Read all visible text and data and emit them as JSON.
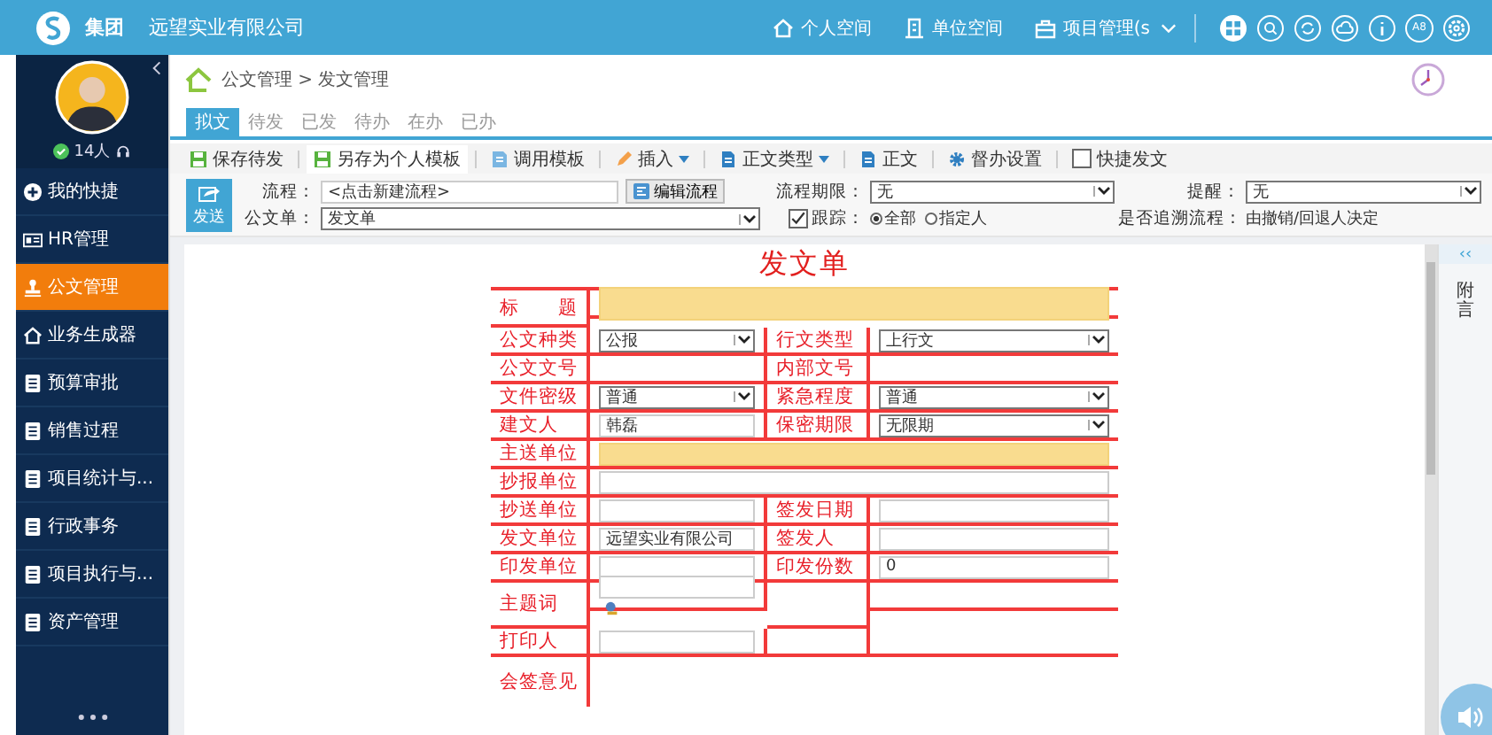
{
  "top_bar": {
    "group": "集团",
    "company": "远望实业有限公司",
    "nav": [
      {
        "label": "个人空间"
      },
      {
        "label": "单位空间"
      },
      {
        "label": "项目管理(s"
      }
    ],
    "badge": "A8"
  },
  "sidebar": {
    "online": "14人",
    "items": [
      {
        "label": "我的快捷",
        "selected": false
      },
      {
        "label": "HR管理",
        "selected": false
      },
      {
        "label": "公文管理",
        "selected": true
      },
      {
        "label": "业务生成器",
        "selected": false
      },
      {
        "label": "预算审批",
        "selected": false
      },
      {
        "label": "销售过程",
        "selected": false
      },
      {
        "label": "项目统计与...",
        "selected": false
      },
      {
        "label": "行政事务",
        "selected": false
      },
      {
        "label": "项目执行与...",
        "selected": false
      },
      {
        "label": "资产管理",
        "selected": false
      }
    ]
  },
  "breadcrumb": "公文管理 > 发文管理",
  "tabs": [
    {
      "label": "拟文",
      "selected": true
    },
    {
      "label": "待发",
      "selected": false
    },
    {
      "label": "已发",
      "selected": false
    },
    {
      "label": "待办",
      "selected": false
    },
    {
      "label": "在办",
      "selected": false
    },
    {
      "label": "已办",
      "selected": false
    }
  ],
  "toolbar": [
    {
      "kind": "button",
      "label": "保存待发"
    },
    {
      "kind": "button",
      "label": "另存为个人模板"
    },
    {
      "kind": "button",
      "label": "调用模板"
    },
    {
      "kind": "dropdown",
      "label": "插入"
    },
    {
      "kind": "dropdown",
      "label": "正文类型"
    },
    {
      "kind": "button",
      "label": "正文"
    },
    {
      "kind": "button",
      "label": "督办设置"
    },
    {
      "kind": "checkbox",
      "label": "快捷发文",
      "checked": false
    }
  ],
  "send_button": "发送",
  "flow": {
    "label": "流程：",
    "value": "<点击新建流程>",
    "edit_button": "编辑流程"
  },
  "deadline": {
    "label": "流程期限：",
    "value": "无"
  },
  "reminder": {
    "label": "提醒：",
    "value": "无"
  },
  "form_select": {
    "label": "公文单：",
    "value": "发文单"
  },
  "track": {
    "label": "跟踪：",
    "checked": true,
    "options": [
      {
        "label": "全部",
        "selected": true
      },
      {
        "label": "指定人",
        "selected": false
      }
    ]
  },
  "trace": {
    "label": "是否追溯流程：",
    "value": "由撤销/回退人决定"
  },
  "document": {
    "title": "发文单",
    "rows": [
      {
        "kind": "full",
        "label": "标　　题",
        "field": {
          "kind": "textarea",
          "required": true
        }
      },
      {
        "kind": "pair",
        "cells": [
          {
            "label": "公文种类",
            "field": {
              "kind": "select",
              "value": "公报",
              "required": false
            }
          },
          {
            "label": "行文类型",
            "field": {
              "kind": "select",
              "value": "上行文",
              "required": false
            }
          }
        ]
      },
      {
        "kind": "pair",
        "cells": [
          {
            "label": "公文文号",
            "field": {
              "kind": "none"
            }
          },
          {
            "label": "内部文号",
            "field": {
              "kind": "none"
            }
          }
        ]
      },
      {
        "kind": "pair",
        "cells": [
          {
            "label": "文件密级",
            "field": {
              "kind": "select",
              "value": "普通",
              "required": false
            }
          },
          {
            "label": "紧急程度",
            "field": {
              "kind": "select",
              "value": "普通",
              "required": false
            }
          }
        ]
      },
      {
        "kind": "pair",
        "cells": [
          {
            "label": "建文人",
            "field": {
              "kind": "input",
              "value": "韩磊",
              "required": false
            }
          },
          {
            "label": "保密期限",
            "field": {
              "kind": "select",
              "value": "无限期",
              "required": false
            }
          }
        ]
      },
      {
        "kind": "full",
        "label": "主送单位",
        "field": {
          "kind": "input",
          "required": true
        }
      },
      {
        "kind": "full",
        "label": "抄报单位",
        "field": {
          "kind": "input",
          "required": false
        }
      },
      {
        "kind": "pair",
        "cells": [
          {
            "label": "抄送单位",
            "field": {
              "kind": "input",
              "required": false
            }
          },
          {
            "label": "签发日期",
            "field": {
              "kind": "input",
              "required": false
            }
          }
        ]
      },
      {
        "kind": "pair",
        "cells": [
          {
            "label": "发文单位",
            "field": {
              "kind": "input",
              "value": "远望实业有限公司",
              "required": false
            }
          },
          {
            "label": "签发人",
            "field": {
              "kind": "input",
              "required": false
            }
          }
        ]
      },
      {
        "kind": "pair",
        "cells": [
          {
            "label": "印发单位",
            "field": {
              "kind": "input",
              "required": false
            }
          },
          {
            "label": "印发份数",
            "field": {
              "kind": "input",
              "value": "0",
              "required": false
            }
          }
        ]
      },
      {
        "kind": "single",
        "label": "主题词",
        "field": {
          "kind": "picker",
          "required": false
        }
      },
      {
        "kind": "single",
        "label": "打印人",
        "field": {
          "kind": "input",
          "required": false
        }
      },
      {
        "kind": "full",
        "label": "会签意见",
        "field": {
          "kind": "area"
        }
      }
    ]
  },
  "side_panel": {
    "collapse": "‹‹",
    "label": "附言"
  }
}
